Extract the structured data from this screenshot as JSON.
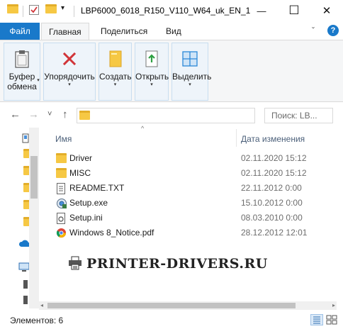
{
  "window": {
    "title": "LBP6000_6018_R150_V110_W64_uk_EN_1",
    "qat_dropdown": "▾",
    "minimize": "—",
    "maximize": "☐",
    "close": "✕"
  },
  "ribbon_tabs": {
    "file": "Файл",
    "home": "Главная",
    "share": "Поделиться",
    "view": "Вид",
    "collapse": "ˇ",
    "help": "?"
  },
  "ribbon_groups": [
    {
      "icon": "clipboard-icon",
      "label_line1": "Буфер",
      "label_line2": "обмена",
      "caret": "▾"
    },
    {
      "icon": "organize-icon",
      "label_line1": "Упорядочить",
      "label_line2": "",
      "caret": "▾"
    },
    {
      "icon": "new-folder-icon",
      "label_line1": "Создать",
      "label_line2": "",
      "caret": "▾"
    },
    {
      "icon": "open-icon",
      "label_line1": "Открыть",
      "label_line2": "",
      "caret": "▾"
    },
    {
      "icon": "select-icon",
      "label_line1": "Выделить",
      "label_line2": "",
      "caret": "▾"
    }
  ],
  "navigation": {
    "back": "←",
    "forward": "→",
    "recent": "˅",
    "up": "↑",
    "address_value": "",
    "search_placeholder": "Поиск: LB...",
    "search_icon": "⌕"
  },
  "columns": {
    "name": "Имя",
    "date": "Дата изменения"
  },
  "files": [
    {
      "name": "Driver",
      "date": "02.11.2020 15:12",
      "type": "folder"
    },
    {
      "name": "MISC",
      "date": "02.11.2020 15:12",
      "type": "folder"
    },
    {
      "name": "README.TXT",
      "date": "22.11.2012 0:00",
      "type": "text"
    },
    {
      "name": "Setup.exe",
      "date": "15.10.2012 0:00",
      "type": "exe"
    },
    {
      "name": "Setup.ini",
      "date": "08.03.2010 0:00",
      "type": "ini"
    },
    {
      "name": "Windows 8_Notice.pdf",
      "date": "28.12.2012 12:01",
      "type": "pdf"
    }
  ],
  "watermark": "PRINTER-DRIVERS.RU",
  "status": {
    "items_count": "Элементов: 6"
  },
  "colors": {
    "accent": "#1979ca",
    "folder": "#f6c844",
    "folder_dark": "#e3ae2a",
    "delete_red": "#d13438",
    "select_blue": "#2b88d8",
    "open_green": "#2ea043"
  }
}
